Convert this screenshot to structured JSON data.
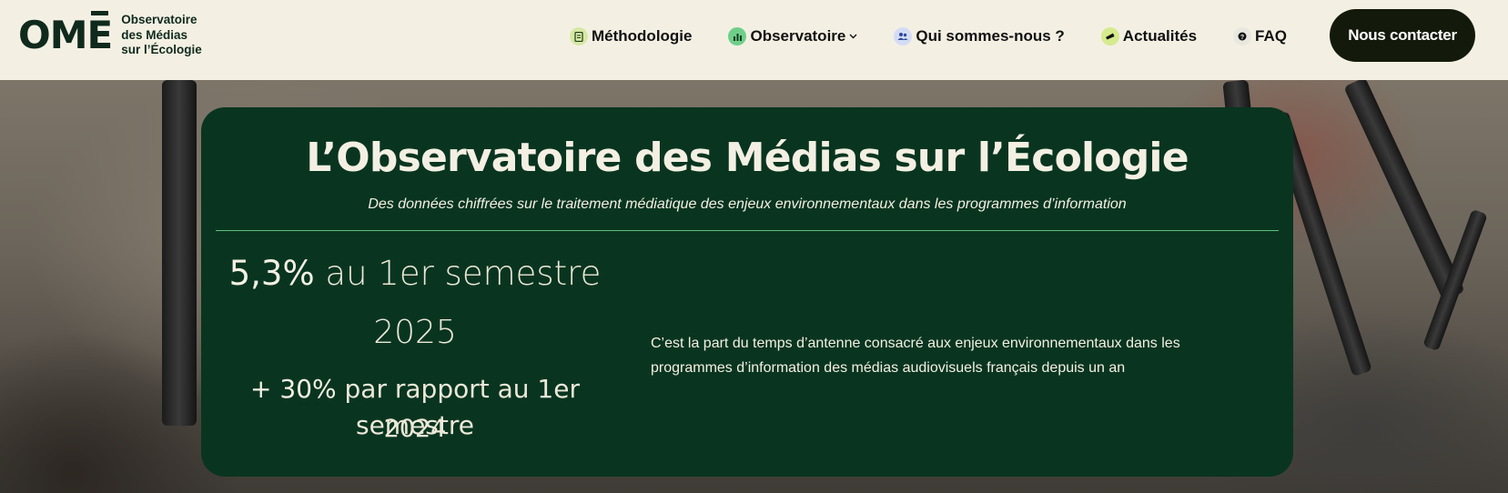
{
  "logo": {
    "mark": "OMĒ",
    "text_line1": "Observatoire",
    "text_line2": "des Médias",
    "text_line3": "sur l’Écologie"
  },
  "nav": {
    "items": [
      {
        "label": "Méthodologie",
        "icon": "document-icon"
      },
      {
        "label": "Observatoire",
        "icon": "bar-chart-icon",
        "has_dropdown": true
      },
      {
        "label": "Qui sommes-nous ?",
        "icon": "people-icon"
      },
      {
        "label": "Actualités",
        "icon": "megaphone-icon"
      },
      {
        "label": "FAQ",
        "icon": "question-icon"
      }
    ],
    "contact_label": "Nous contacter"
  },
  "hero": {
    "title": "L’Observatoire des Médias sur l’Écologie",
    "subtitle": "Des données chiffrées sur le traitement médiatique des enjeux environnementaux dans les programmes d’information",
    "stat_value": "5,3%",
    "stat_period": "au 1er semestre",
    "stat_year": "2025",
    "change_value": "+ 30%",
    "change_text": "par rapport au 1er semestre",
    "change_year": "2024",
    "description": "C’est la part du temps d’antenne consacré aux enjeux environnementaux dans les programmes d’information des médias audiovisuels français depuis un an"
  },
  "colors": {
    "header_bg": "#f3f0e3",
    "card_bg": "#093520",
    "accent_green": "#5fbf78",
    "button_bg": "#141a0b"
  }
}
